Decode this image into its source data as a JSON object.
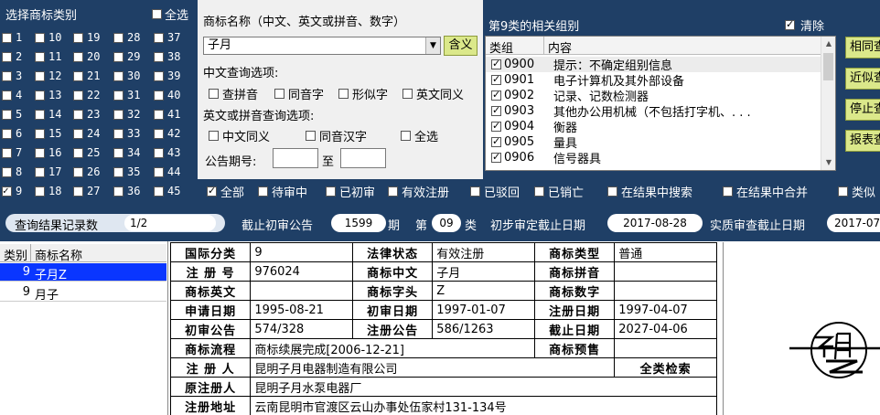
{
  "categories": {
    "title": "选择商标类别",
    "select_all_label": "全选",
    "numbers": [
      1,
      2,
      3,
      4,
      5,
      6,
      7,
      8,
      9,
      10,
      11,
      12,
      13,
      14,
      15,
      16,
      17,
      18,
      19,
      20,
      21,
      22,
      23,
      24,
      25,
      26,
      27,
      28,
      29,
      30,
      31,
      32,
      33,
      34,
      35,
      36,
      37,
      38,
      39,
      40,
      41,
      42,
      43,
      44,
      45
    ],
    "checked": [
      9
    ]
  },
  "name_search": {
    "label": "商标名称（中文、英文或拼音、数字）",
    "value": "子月",
    "meaning_button": "含义",
    "cn_options_label": "中文查询选项:",
    "cn_options": [
      "查拼音",
      "同音字",
      "形似字",
      "英文同义"
    ],
    "en_options_label": "英文或拼音查询选项:",
    "en_options": [
      "中文同义",
      "同音汉字",
      "全选"
    ],
    "issue_label": "公告期号:",
    "issue_to": "至"
  },
  "groups": {
    "title": "第9类的相关组别",
    "clear_label": "清除",
    "col_group": "类组",
    "col_content": "内容",
    "rows": [
      {
        "code": "0900",
        "text": "提示：不确定组别信息"
      },
      {
        "code": "0901",
        "text": "电子计算机及其外部设备"
      },
      {
        "code": "0902",
        "text": "记录、记数检测器"
      },
      {
        "code": "0903",
        "text": "其他办公用机械（不包括打字机、. . ."
      },
      {
        "code": "0904",
        "text": "衡器"
      },
      {
        "code": "0905",
        "text": "量具"
      },
      {
        "code": "0906",
        "text": "信号器具"
      }
    ]
  },
  "side_buttons": [
    "相同查",
    "近似查",
    "停止查",
    "报表查"
  ],
  "filters": [
    {
      "label": "全部",
      "checked": true
    },
    {
      "label": "待审中",
      "checked": false
    },
    {
      "label": "已初审",
      "checked": false
    },
    {
      "label": "有效注册",
      "checked": false
    },
    {
      "label": "已驳回",
      "checked": false
    },
    {
      "label": "已销亡",
      "checked": false
    },
    {
      "label": "在结果中搜索",
      "checked": false
    },
    {
      "label": "在结果中合并",
      "checked": false
    },
    {
      "label": "类似",
      "checked": false
    }
  ],
  "stats": {
    "result_label": "查询结果记录数",
    "result_value": "1/2",
    "cutoff_label": "截止初审公告",
    "cutoff_value": "1599",
    "cutoff_unit": "期",
    "class_prefix": "第",
    "class_value": "09",
    "class_suffix": "类",
    "initial_label": "初步审定截止日期",
    "initial_value": "2017-08-28",
    "exam_label": "实质审查截止日期",
    "exam_value": "2017-07"
  },
  "results": {
    "col_class": "类别",
    "col_name": "商标名称",
    "rows": [
      {
        "cls": "9",
        "name": "子月Z"
      },
      {
        "cls": "9",
        "name": "月子"
      }
    ]
  },
  "detail": {
    "intl_class_k": "国际分类",
    "intl_class_v": "9",
    "legal_k": "法律状态",
    "legal_v": "有效注册",
    "type_k": "商标类型",
    "type_v": "普通",
    "reg_no_k": "注 册 号",
    "reg_no_v": "976024",
    "cn_k": "商标中文",
    "cn_v": "子月",
    "pinyin_k": "商标拼音",
    "pinyin_v": "",
    "en_k": "商标英文",
    "en_v": "",
    "letter_k": "商标字头",
    "letter_v": "Z",
    "digit_k": "商标数字",
    "digit_v": "",
    "apply_k": "申请日期",
    "apply_v": "1995-08-21",
    "init_date_k": "初审日期",
    "init_date_v": "1997-01-07",
    "reg_date_k": "注册日期",
    "reg_date_v": "1997-04-07",
    "init_pub_k": "初审公告",
    "init_pub_v": "574/328",
    "reg_pub_k": "注册公告",
    "reg_pub_v": "586/1263",
    "expiry_k": "截止日期",
    "expiry_v": "2027-04-06",
    "flow_k": "商标流程",
    "flow_v": "商标续展完成[2006-12-21]",
    "warn_k": "商标预售",
    "warn_v": "",
    "owner_k": "注 册 人",
    "owner_v": "昆明子月电器制造有限公司",
    "all_class_link": "全类检索",
    "orig_owner_k": "原注册人",
    "orig_owner_v": "昆明子月水泵电器厂",
    "addr_k": "注册地址",
    "addr_v": "云南昆明市官渡区云山办事处伍家村131-134号"
  },
  "colors": {
    "panel_navy": "#1f3f66",
    "button_lime": "#dbe88a",
    "selection_blue": "#0a36ff"
  }
}
